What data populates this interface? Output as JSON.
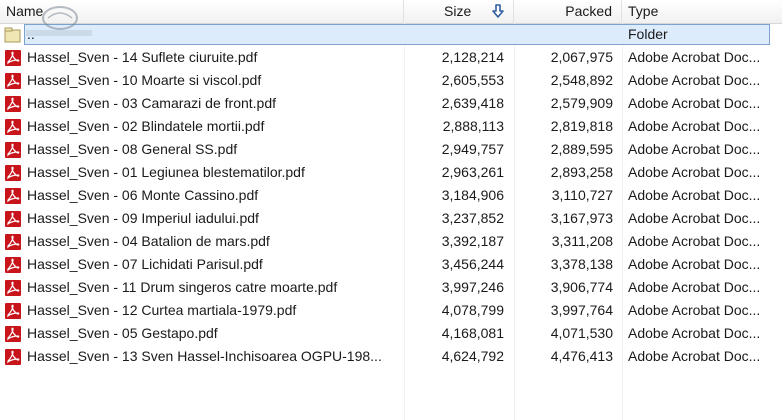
{
  "columns": {
    "name": "Name",
    "size": "Size",
    "packed": "Packed",
    "type": "Type"
  },
  "sort": {
    "column": "size",
    "icon": "sort-descending-arrow-icon"
  },
  "parent_row": {
    "name": "..",
    "type": "Folder",
    "icon": "folder-up-icon"
  },
  "files": [
    {
      "name": "Hassel_Sven - 14 Suflete ciuruite.pdf",
      "size": "2,128,214",
      "packed": "2,067,975",
      "type": "Adobe Acrobat Doc..."
    },
    {
      "name": "Hassel_Sven - 10 Moarte si viscol.pdf",
      "size": "2,605,553",
      "packed": "2,548,892",
      "type": "Adobe Acrobat Doc..."
    },
    {
      "name": "Hassel_Sven - 03 Camarazi de front.pdf",
      "size": "2,639,418",
      "packed": "2,579,909",
      "type": "Adobe Acrobat Doc..."
    },
    {
      "name": "Hassel_Sven - 02 Blindatele mortii.pdf",
      "size": "2,888,113",
      "packed": "2,819,818",
      "type": "Adobe Acrobat Doc..."
    },
    {
      "name": "Hassel_Sven - 08 General SS.pdf",
      "size": "2,949,757",
      "packed": "2,889,595",
      "type": "Adobe Acrobat Doc..."
    },
    {
      "name": "Hassel_Sven - 01 Legiunea blestematilor.pdf",
      "size": "2,963,261",
      "packed": "2,893,258",
      "type": "Adobe Acrobat Doc..."
    },
    {
      "name": "Hassel_Sven - 06 Monte Cassino.pdf",
      "size": "3,184,906",
      "packed": "3,110,727",
      "type": "Adobe Acrobat Doc..."
    },
    {
      "name": "Hassel_Sven - 09 Imperiul iadului.pdf",
      "size": "3,237,852",
      "packed": "3,167,973",
      "type": "Adobe Acrobat Doc..."
    },
    {
      "name": "Hassel_Sven - 04 Batalion de mars.pdf",
      "size": "3,392,187",
      "packed": "3,311,208",
      "type": "Adobe Acrobat Doc..."
    },
    {
      "name": "Hassel_Sven - 07 Lichidati Parisul.pdf",
      "size": "3,456,244",
      "packed": "3,378,138",
      "type": "Adobe Acrobat Doc..."
    },
    {
      "name": "Hassel_Sven - 11 Drum singeros catre moarte.pdf",
      "size": "3,997,246",
      "packed": "3,906,774",
      "type": "Adobe Acrobat Doc..."
    },
    {
      "name": "Hassel_Sven - 12 Curtea martiala-1979.pdf",
      "size": "4,078,799",
      "packed": "3,997,764",
      "type": "Adobe Acrobat Doc..."
    },
    {
      "name": "Hassel_Sven - 05 Gestapo.pdf",
      "size": "4,168,081",
      "packed": "4,071,530",
      "type": "Adobe Acrobat Doc..."
    },
    {
      "name": "Hassel_Sven - 13 Sven Hassel-Inchisoarea OGPU-198...",
      "size": "4,624,792",
      "packed": "4,476,413",
      "type": "Adobe Acrobat Doc..."
    }
  ],
  "file_icon": "pdf-file-icon",
  "colors": {
    "pdf_red": "#c8151b",
    "selection_fill": "#dcecfc",
    "selection_border": "#7da2ce",
    "sort_arrow": "#2f5f9e"
  }
}
